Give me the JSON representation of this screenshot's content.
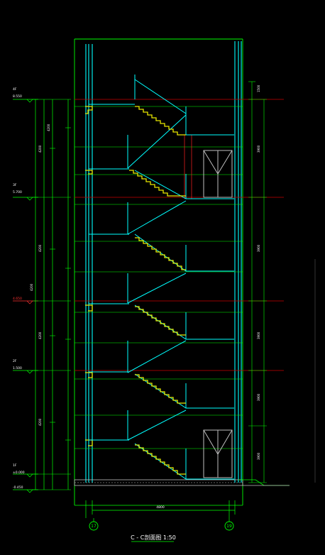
{
  "drawing": {
    "title": "C - C剖面图 1:50",
    "axis_left": "17",
    "axis_right": "19",
    "bottom_dim": "4800"
  },
  "levels": [
    {
      "floor": "4F",
      "elev": "8.550"
    },
    {
      "floor": "3F",
      "elev": "5.700"
    },
    {
      "floor": "",
      "elev": "4.650"
    },
    {
      "floor": "2F",
      "elev": "1.500"
    },
    {
      "floor": "1F",
      "elev": "±0.000"
    },
    {
      "floor": "",
      "elev": "-0.450"
    }
  ],
  "left_dims": [
    "4200",
    "4200",
    "4200",
    "4200",
    "4200",
    "4200"
  ],
  "right_dims": [
    "1500",
    "3900",
    "3900",
    "3900",
    "3900",
    "3900"
  ],
  "colors": {
    "background": "#000000",
    "structure": "#00ff00",
    "stair": "#00ffff",
    "tread": "#ffff00",
    "axis": "#ff0000",
    "door": "#bfbfbf"
  }
}
